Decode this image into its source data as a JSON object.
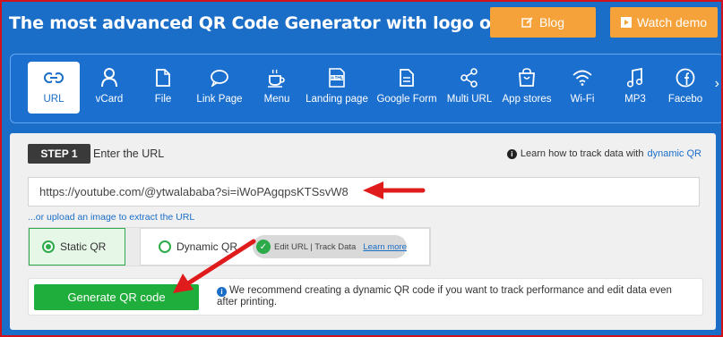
{
  "header": {
    "title": "The most advanced QR Code Generator with logo online",
    "blog_label": "Blog",
    "demo_label": "Watch demo"
  },
  "qr_types": [
    {
      "label": "URL",
      "icon": "link-icon"
    },
    {
      "label": "vCard",
      "icon": "person-icon"
    },
    {
      "label": "File",
      "icon": "file-icon"
    },
    {
      "label": "Link Page",
      "icon": "chat-bubble-icon"
    },
    {
      "label": "Menu",
      "icon": "coffee-cup-icon"
    },
    {
      "label": "Landing page",
      "icon": "html-page-icon"
    },
    {
      "label": "Google Form",
      "icon": "form-icon"
    },
    {
      "label": "Multi URL",
      "icon": "share-icon"
    },
    {
      "label": "App stores",
      "icon": "shopping-bag-icon"
    },
    {
      "label": "Wi-Fi",
      "icon": "wifi-icon"
    },
    {
      "label": "MP3",
      "icon": "music-note-icon"
    },
    {
      "label": "Facebo",
      "icon": "facebook-icon"
    }
  ],
  "selected_type": "URL",
  "step": {
    "badge": "STEP 1",
    "label": "Enter the URL",
    "learn_text": "Learn how to track data with",
    "learn_link": "dynamic QR"
  },
  "url_input": {
    "value": "https://youtube.com/@ytwalababa?si=iWoPAgqpsKTSsvW8"
  },
  "upload_link": "...or upload an image to extract the URL",
  "qr_mode": {
    "static_label": "Static QR",
    "dynamic_label": "Dynamic QR",
    "selected": "static",
    "feature_text": "Edit URL | Track Data",
    "feature_link": "Learn more"
  },
  "generate": {
    "button_label": "Generate QR code",
    "note": "We recommend creating a dynamic QR code if you want to track performance and edit data even after printing."
  },
  "colors": {
    "brand_blue": "#1a6ec8",
    "accent_orange": "#f5a23a",
    "generate_green": "#1fae3b",
    "annotation_red": "#e01b1b"
  }
}
